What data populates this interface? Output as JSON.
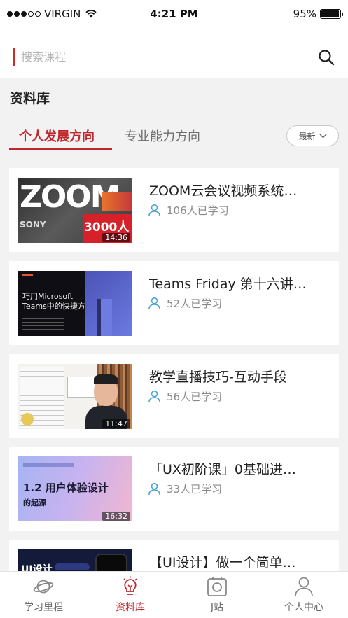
{
  "status_bar": {
    "carrier": "VIRGIN",
    "time": "4:21 PM",
    "battery": "95%",
    "battery_level": 0.95,
    "signal_bars": 3,
    "signal_total": 5
  },
  "search": {
    "placeholder": "搜索课程",
    "icon": "magnifier"
  },
  "section": {
    "title": "资料库"
  },
  "tabs": [
    {
      "label": "个人发展方向",
      "active": true
    },
    {
      "label": "专业能力方向",
      "active": false
    }
  ],
  "sort": {
    "label": "最新",
    "icon": "chevron-down"
  },
  "courses": [
    {
      "title": "ZOOM云会议视频系统…",
      "learners": "106人已学习",
      "duration": "14:36",
      "thumb_text": {
        "headline": "ZOOM",
        "number": "3000人",
        "sub": "SONY"
      }
    },
    {
      "title": "Teams Friday 第十六讲…",
      "learners": "52人已学习",
      "duration": "",
      "thumb_text": {
        "headline": "巧用Microsoft\nTeams中的快捷方式"
      }
    },
    {
      "title": "教学直播技巧-互动手段",
      "learners": "56人已学习",
      "duration": "11:47",
      "thumb_text": {}
    },
    {
      "title": "「UX初阶课」0基础进…",
      "learners": "33人已学习",
      "duration": "16:32",
      "thumb_text": {
        "headline": "1.2 用户体验设计",
        "sub": "的起源"
      }
    },
    {
      "title": "【UI设计】做一个简单…",
      "learners": "",
      "duration": "",
      "thumb_text": {
        "headline": "UI设计"
      }
    }
  ],
  "bottom_nav": [
    {
      "label": "学习里程",
      "icon": "planet-icon",
      "active": false
    },
    {
      "label": "资料库",
      "icon": "lightbulb-icon",
      "active": true
    },
    {
      "label": "J站",
      "icon": "camera-icon",
      "active": false
    },
    {
      "label": "个人中心",
      "icon": "person-icon",
      "active": false
    }
  ],
  "colors": {
    "accent": "#c0272d",
    "learner_icon": "#4aa3d6",
    "background": "#f2f2f2"
  }
}
